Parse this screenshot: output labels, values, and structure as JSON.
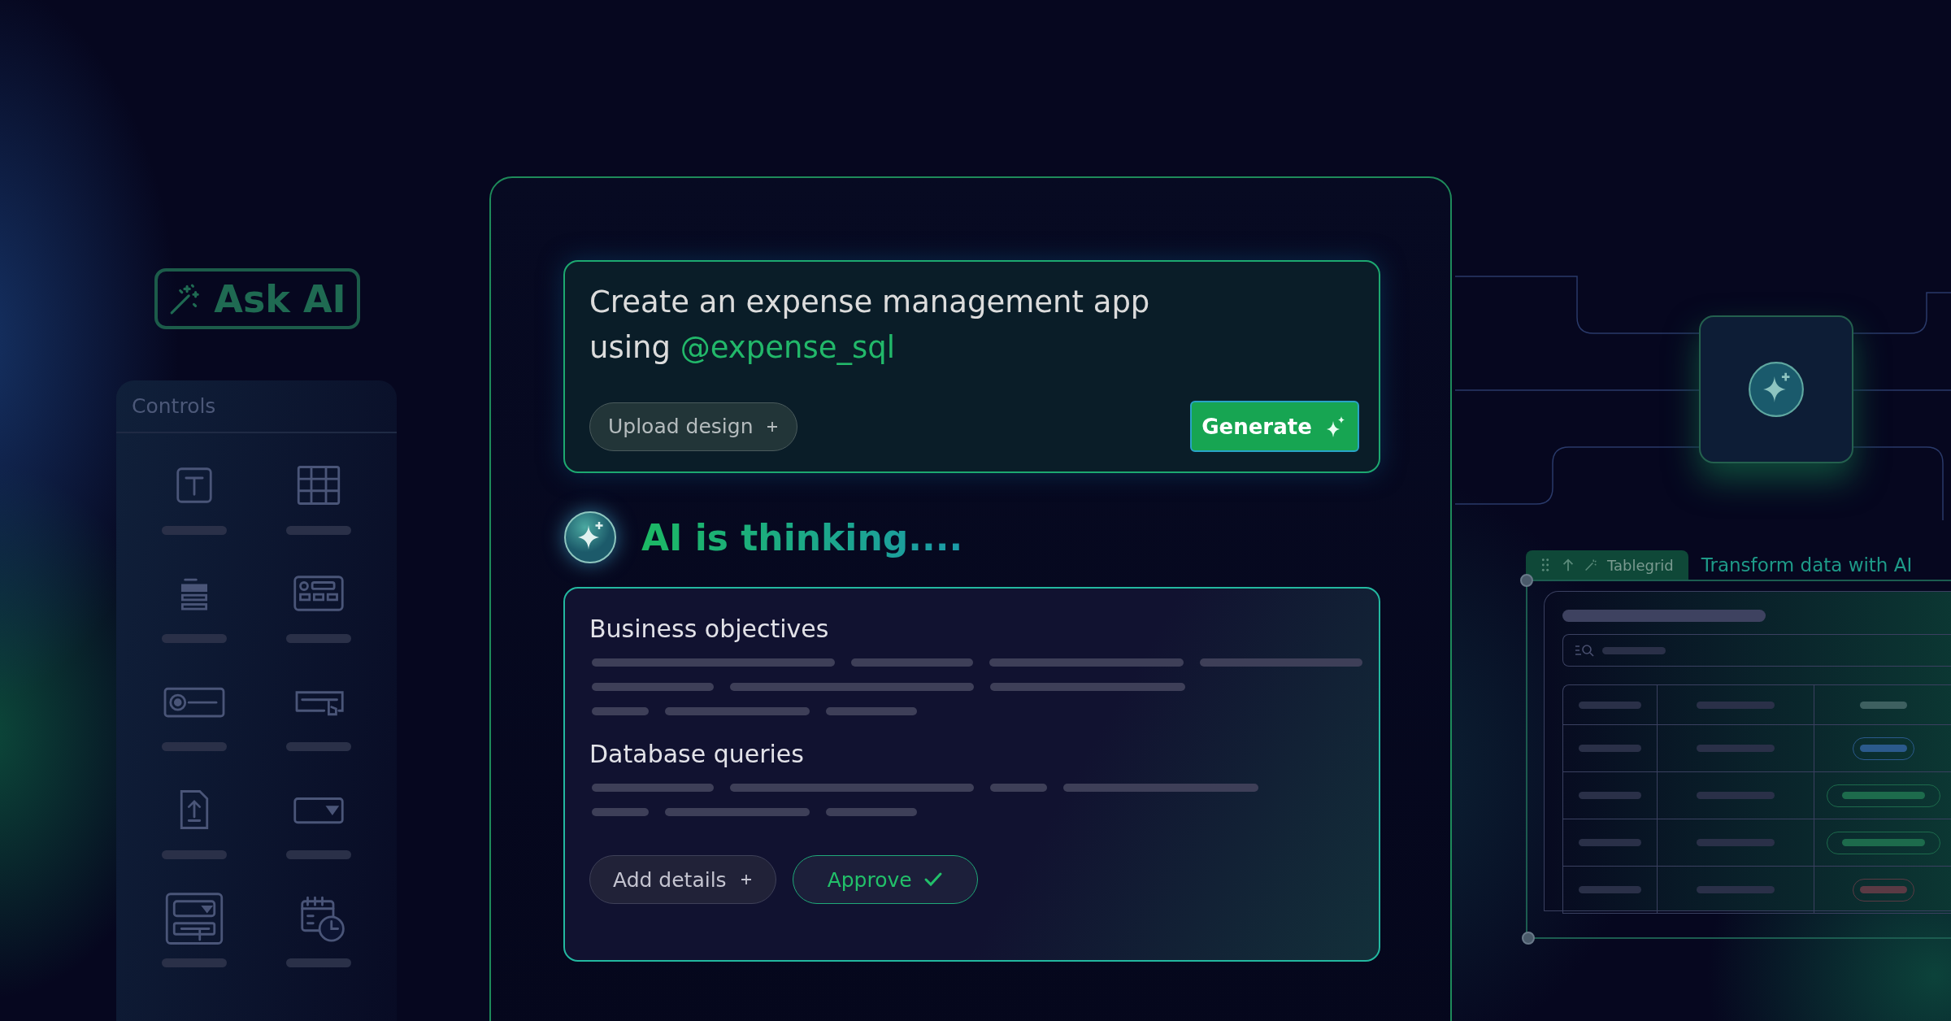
{
  "ask_ai_button": {
    "label": "Ask AI"
  },
  "controls_panel": {
    "title": "Controls",
    "items": [
      {
        "kind": "text"
      },
      {
        "kind": "table"
      },
      {
        "kind": "list"
      },
      {
        "kind": "form"
      },
      {
        "kind": "radio"
      },
      {
        "kind": "button"
      },
      {
        "kind": "upload"
      },
      {
        "kind": "dropdown"
      },
      {
        "kind": "combo"
      },
      {
        "kind": "datetime"
      }
    ]
  },
  "prompt": {
    "text": "Create an expense management app using",
    "mention": "@expense_sql",
    "upload_button": "Upload design",
    "generate_button": "Generate"
  },
  "status": {
    "text": "AI is thinking...."
  },
  "result": {
    "sections": [
      {
        "title": "Business objectives"
      },
      {
        "title": "Database queries"
      }
    ],
    "buttons": [
      {
        "label": "Add details",
        "kind": "add"
      },
      {
        "label": "Approve",
        "kind": "approve"
      }
    ]
  },
  "tablegrid": {
    "tab_label": "Tablegrid",
    "caption": "Transform data with AI",
    "rows": [
      {
        "color": "#2b5a8c"
      },
      {
        "color": "#1d6b4c"
      },
      {
        "color": "#1d6b4c"
      },
      {
        "color": "#5a3a44"
      }
    ]
  }
}
